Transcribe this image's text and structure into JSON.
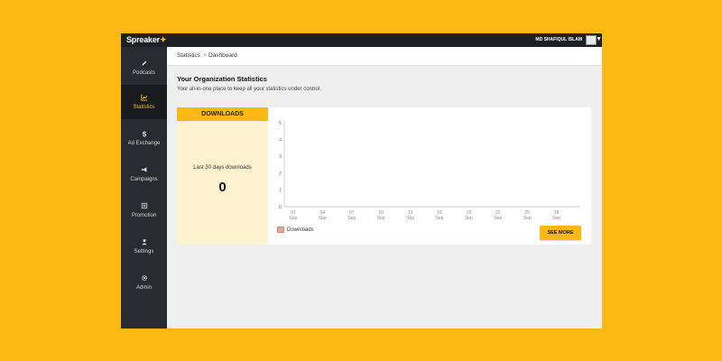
{
  "app": {
    "brand": "Spreaker",
    "brand_star": "✦"
  },
  "topbar": {
    "user_name": "MD SHAFIQUL ISLAM"
  },
  "sidebar": {
    "items": [
      {
        "label": "Podcasts",
        "icon": "pencil-icon",
        "active": false
      },
      {
        "label": "Statistics",
        "icon": "chart-icon",
        "active": true
      },
      {
        "label": "Ad Exchange",
        "icon": "dollar-icon",
        "active": false
      },
      {
        "label": "Campaigns",
        "icon": "megaphone-icon",
        "active": false
      },
      {
        "label": "Promotion",
        "icon": "promotion-icon",
        "active": false
      },
      {
        "label": "Settings",
        "icon": "user-icon",
        "active": false
      },
      {
        "label": "Admin",
        "icon": "gear-icon",
        "active": false
      }
    ]
  },
  "breadcrumb": {
    "parent": "Statistics",
    "separator": ">",
    "current": "Dashboard"
  },
  "main": {
    "title": "Your Organization Statistics",
    "subtitle": "Your all-in-one place to keep all your statistics under control."
  },
  "downloads": {
    "header": "DOWNLOADS",
    "label": "Last 30 days downloads",
    "count": "0",
    "see_more_label": "SEE MORE",
    "legend_label": "Downloads"
  },
  "colors": {
    "accent": "#FDB913",
    "sidebar": "#2a2b30",
    "legend": "#e2a999"
  },
  "chart_data": {
    "type": "bar",
    "categories": [
      "01 Sep",
      "04 Sep",
      "07 Sep",
      "10 Sep",
      "13 Sep",
      "16 Sep",
      "19 Sep",
      "22 Sep",
      "25 Sep",
      "28 Sep"
    ],
    "x_ticks": [
      [
        "01",
        "Sep"
      ],
      [
        "04",
        "Sep"
      ],
      [
        "07",
        "Sep"
      ],
      [
        "10",
        "Sep"
      ],
      [
        "13",
        "Sep"
      ],
      [
        "16",
        "Sep"
      ],
      [
        "19",
        "Sep"
      ],
      [
        "22",
        "Sep"
      ],
      [
        "25",
        "Sep"
      ],
      [
        "28",
        "Sep"
      ]
    ],
    "series": [
      {
        "name": "Downloads",
        "values": [
          0,
          0,
          0,
          0,
          0,
          0,
          0,
          0,
          0,
          0
        ]
      }
    ],
    "y_ticks": [
      0,
      1,
      2,
      3,
      4,
      5
    ],
    "ylim": [
      0,
      5
    ],
    "grid": false,
    "legend": "bottom-left"
  }
}
